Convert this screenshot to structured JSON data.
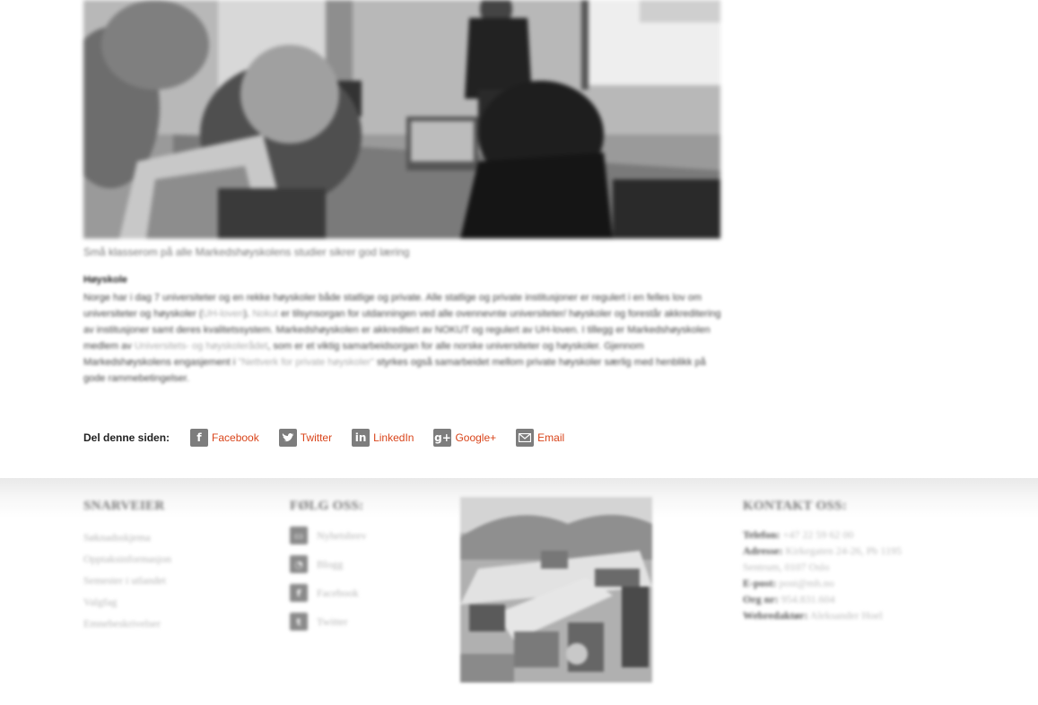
{
  "article": {
    "caption": "Små klasserom på alle Markedshøyskolens studier sikrer god læring",
    "heading": "Høyskole",
    "body": {
      "p1": "Norge har i dag 7 universiteter og en rekke høyskoler både statlige og private. Alle statlige og private institusjoner er regulert i en felles lov om universiteter og høyskoler (",
      "link_uh_lov": "UH-loven",
      "p2": "). ",
      "link_nokut": "Nokut",
      "p3": " er tilsynsorgan for utdanningen ved alle ovennevnte universiteter/ høyskoler og forestår akkreditering av institusjoner samt deres kvalitetssystem. Markedshøyskolen er akkreditert av NOKUT og regulert av UH-loven. I tillegg er Markedshøyskolen medlem av ",
      "link_uhr": "Universitets- og høyskolerådet",
      "p4": ", som er et viktig samarbeidsorgan for alle norske universiteter og høyskoler. Gjennom Markedshøyskolens engasjement i ",
      "link_nettverk": "\"Nettverk for private høyskoler\"",
      "p5": " styrkes også samarbeidet mellom private høyskoler særlig med henblikk på gode rammebetingelser."
    }
  },
  "share": {
    "label": "Del denne siden:",
    "items": [
      {
        "label": "Facebook",
        "icon": "facebook-icon"
      },
      {
        "label": "Twitter",
        "icon": "twitter-icon"
      },
      {
        "label": "LinkedIn",
        "icon": "linkedin-icon"
      },
      {
        "label": "Google+",
        "icon": "googleplus-icon"
      },
      {
        "label": "Email",
        "icon": "email-icon"
      }
    ],
    "link_color": "#d9441a"
  },
  "footer": {
    "shortcuts": {
      "title": "SNARVEIER",
      "links": [
        "Søknadsskjema",
        "Opptaksinformasjon",
        "Semester i utlandet",
        "Valgfag",
        "Emnebeskrivelser"
      ]
    },
    "follow": {
      "title": "FØLG OSS:",
      "items": [
        {
          "label": "Nyhetsbrev",
          "icon": "newsletter-icon"
        },
        {
          "label": "Blogg",
          "icon": "rss-icon"
        },
        {
          "label": "Facebook",
          "icon": "facebook-icon"
        },
        {
          "label": "Twitter",
          "icon": "twitter-icon"
        }
      ]
    },
    "contact": {
      "title": "KONTAKT OSS:",
      "phone_label": "Telefon:",
      "phone": "+47 22 59 62 00",
      "address_label": "Adresse:",
      "address_line1": "Kirkegaten 24-26, Pb 1195",
      "address_line2": "Sentrum, 0107 Oslo",
      "email_label": "E-post:",
      "email": "post@mh.no",
      "org_label": "Org nr:",
      "org": "954.831.604",
      "webeditor_label": "Webredaktør:",
      "webeditor": "Aleksander Hoel"
    }
  }
}
